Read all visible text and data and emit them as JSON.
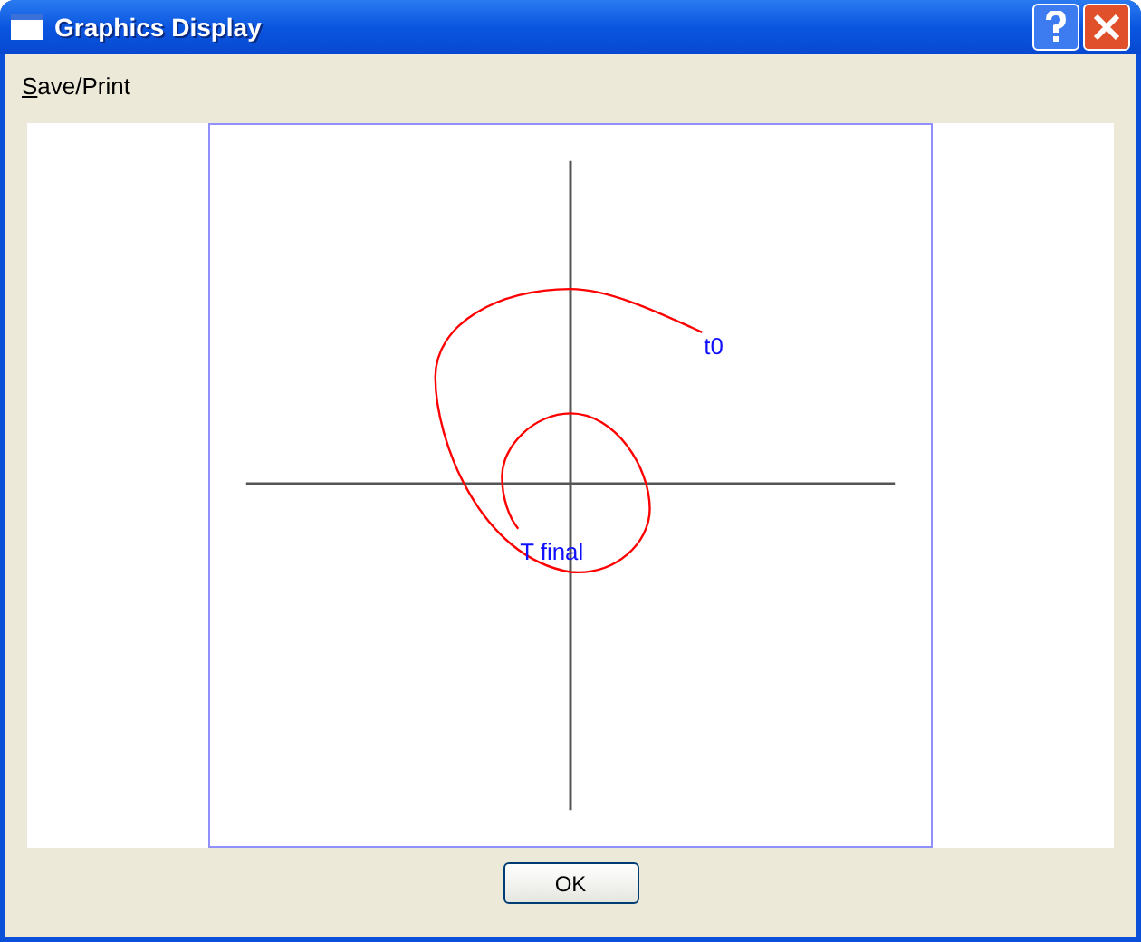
{
  "window": {
    "title": "Graphics Display"
  },
  "menu": [
    {
      "mnemonic": "S",
      "rest": "ave/Print"
    }
  ],
  "plot": {
    "start_label": "t0",
    "end_label": "T final"
  },
  "buttons": [
    "OK"
  ]
}
